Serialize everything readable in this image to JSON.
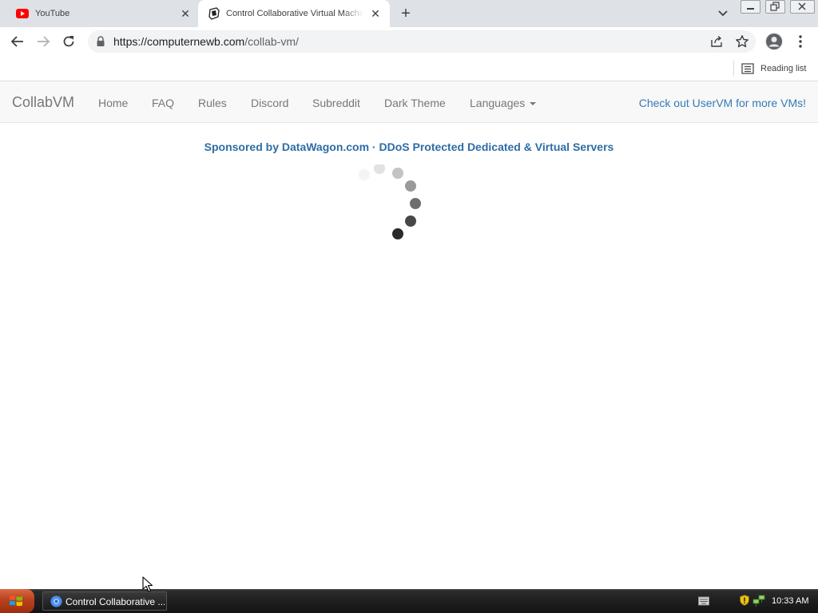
{
  "browser": {
    "tabs": [
      {
        "title": "YouTube",
        "active": false,
        "favicon": "youtube-icon"
      },
      {
        "title": "Control Collaborative Virtual Machines!",
        "active": true,
        "favicon": "collabvm-icon"
      }
    ],
    "address": {
      "host": "https://computernewb.com",
      "path": "/collab-vm/"
    },
    "reading_list_label": "Reading list"
  },
  "site": {
    "brand": "CollabVM",
    "nav": [
      {
        "label": "Home"
      },
      {
        "label": "FAQ"
      },
      {
        "label": "Rules"
      },
      {
        "label": "Discord"
      },
      {
        "label": "Subreddit"
      },
      {
        "label": "Dark Theme"
      },
      {
        "label": "Languages"
      }
    ],
    "nav_right": "Check out UserVM for more VMs!",
    "sponsor": {
      "prefix": "Sponsored by ",
      "link": "DataWagon.com · DDoS Protected Dedicated & Virtual Servers"
    },
    "loading": true
  },
  "taskbar": {
    "task_label": "Control Collaborative ...",
    "clock": "10:33 AM"
  },
  "colors": {
    "accent_link": "#337ab7",
    "sponsor": "#2e6da4",
    "navbar_bg": "#f8f8f8"
  }
}
